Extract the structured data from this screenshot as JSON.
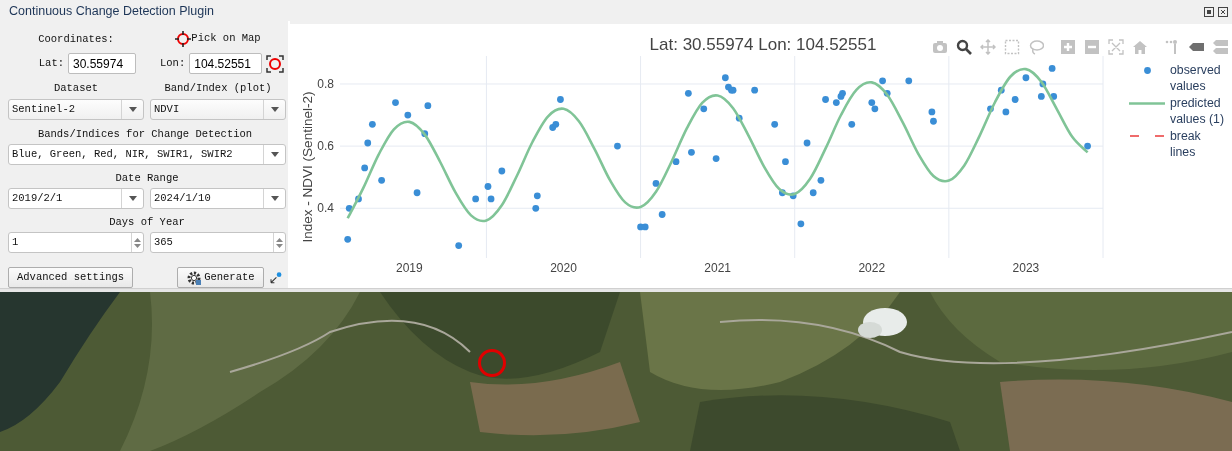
{
  "window": {
    "title": "Continuous Change Detection Plugin"
  },
  "coordinates": {
    "label": "Coordinates:",
    "pick_label": "Pick on Map",
    "lat_label": "Lat:",
    "lat": "30.55974",
    "lon_label": "Lon:",
    "lon": "104.52551"
  },
  "dataset": {
    "label": "Dataset",
    "value": "Sentinel-2"
  },
  "band_plot": {
    "label": "Band/Index (plot)",
    "value": "NDVI"
  },
  "bands_detection": {
    "label": "Bands/Indices for Change Detection",
    "value": "Blue, Green, Red, NIR, SWIR1, SWIR2"
  },
  "date_range": {
    "label": "Date Range",
    "start": "2019/2/1",
    "end": "2024/1/10"
  },
  "days_of_year": {
    "label": "Days of Year",
    "start": "1",
    "end": "365"
  },
  "buttons": [
    {
      "label": "Advanced settings",
      "kind": "plain"
    },
    {
      "label": "Generate",
      "kind": "gear"
    }
  ],
  "chart": {
    "toolbar": [
      {
        "kind": "camera",
        "selected": false
      },
      {
        "kind": "zoom",
        "selected": true
      },
      {
        "kind": "pan",
        "selected": false
      },
      {
        "kind": "box",
        "selected": false
      },
      {
        "kind": "lasso",
        "selected": false
      },
      {
        "kind": "zoomin",
        "selected": false
      },
      {
        "kind": "zoomout",
        "selected": false
      },
      {
        "kind": "autoscale",
        "selected": false
      },
      {
        "kind": "home",
        "selected": false
      },
      {
        "kind": "spike",
        "selected": false
      },
      {
        "kind": "closest",
        "selected": true
      },
      {
        "kind": "compare",
        "selected": false
      }
    ],
    "chart_data": {
      "type": "scatter",
      "title": "Lat: 30.55974 Lon: 104.52551",
      "ylabel": "Index - NDVI (Sentinel-2)",
      "xlim": [
        2019.05,
        2024.0
      ],
      "ylim": [
        0.24,
        0.89
      ],
      "grid": true,
      "xticks": [
        {
          "value": 2019.5,
          "label": "2019"
        },
        {
          "value": 2020.5,
          "label": "2020"
        },
        {
          "value": 2021.5,
          "label": "2021"
        },
        {
          "value": 2022.5,
          "label": "2022"
        },
        {
          "value": 2023.5,
          "label": "2023"
        }
      ],
      "yticks": [
        0.4,
        0.6,
        0.8
      ],
      "series": [
        {
          "name": "observed values",
          "color": "#3a8ed6",
          "type": "scatter",
          "x": [
            2019.1,
            2019.11,
            2019.17,
            2019.21,
            2019.23,
            2019.26,
            2019.32,
            2019.41,
            2019.49,
            2019.55,
            2019.6,
            2019.62,
            2019.82,
            2019.93,
            2020.01,
            2020.03,
            2020.1,
            2020.32,
            2020.33,
            2020.43,
            2020.45,
            2020.48,
            2020.85,
            2021.0,
            2021.03,
            2021.1,
            2021.14,
            2021.23,
            2021.31,
            2021.33,
            2021.41,
            2021.49,
            2021.55,
            2021.57,
            2021.59,
            2021.6,
            2021.64,
            2021.74,
            2021.87,
            2021.92,
            2021.94,
            2021.99,
            2022.04,
            2022.08,
            2022.12,
            2022.17,
            2022.2,
            2022.27,
            2022.3,
            2022.31,
            2022.37,
            2022.5,
            2022.52,
            2022.57,
            2022.6,
            2022.74,
            2022.89,
            2022.9,
            2023.27,
            2023.34,
            2023.37,
            2023.43,
            2023.5,
            2023.6,
            2023.61,
            2023.67,
            2023.68,
            2023.9
          ],
          "values": [
            0.3,
            0.4,
            0.43,
            0.53,
            0.61,
            0.67,
            0.49,
            0.74,
            0.7,
            0.45,
            0.64,
            0.73,
            0.28,
            0.43,
            0.47,
            0.43,
            0.52,
            0.4,
            0.44,
            0.66,
            0.67,
            0.75,
            0.6,
            0.34,
            0.34,
            0.48,
            0.38,
            0.55,
            0.77,
            0.58,
            0.72,
            0.56,
            0.82,
            0.79,
            0.78,
            0.78,
            0.69,
            0.78,
            0.67,
            0.45,
            0.55,
            0.44,
            0.35,
            0.61,
            0.45,
            0.49,
            0.75,
            0.74,
            0.76,
            0.77,
            0.67,
            0.74,
            0.72,
            0.81,
            0.77,
            0.81,
            0.71,
            0.68,
            0.72,
            0.78,
            0.71,
            0.75,
            0.82,
            0.76,
            0.8,
            0.85,
            0.76,
            0.6
          ]
        },
        {
          "name": "predicted values (1)",
          "color": "#80c497",
          "type": "line",
          "x": [
            2019.1,
            2019.2,
            2019.3,
            2019.4,
            2019.5,
            2019.6,
            2019.7,
            2019.8,
            2019.9,
            2020.0,
            2020.1,
            2020.2,
            2020.3,
            2020.4,
            2020.5,
            2020.6,
            2020.7,
            2020.8,
            2020.9,
            2021.0,
            2021.1,
            2021.2,
            2021.3,
            2021.4,
            2021.5,
            2021.6,
            2021.7,
            2021.8,
            2021.9,
            2022.0,
            2022.1,
            2022.2,
            2022.3,
            2022.4,
            2022.5,
            2022.6,
            2022.7,
            2022.8,
            2022.9,
            2023.0,
            2023.1,
            2023.2,
            2023.3,
            2023.4,
            2023.5,
            2023.6,
            2023.7,
            2023.8,
            2023.9
          ],
          "values": [
            0.368,
            0.464,
            0.572,
            0.654,
            0.678,
            0.637,
            0.549,
            0.45,
            0.377,
            0.361,
            0.41,
            0.507,
            0.615,
            0.696,
            0.72,
            0.68,
            0.592,
            0.492,
            0.419,
            0.404,
            0.453,
            0.549,
            0.657,
            0.739,
            0.763,
            0.722,
            0.634,
            0.535,
            0.462,
            0.446,
            0.495,
            0.592,
            0.7,
            0.781,
            0.805,
            0.765,
            0.677,
            0.577,
            0.504,
            0.489,
            0.538,
            0.634,
            0.742,
            0.824,
            0.848,
            0.807,
            0.719,
            0.63,
            0.58
          ]
        }
      ]
    },
    "legend_extra": [
      {
        "label": "break lines",
        "color": "#ef6b6b",
        "kind": "dash"
      }
    ]
  },
  "map": {
    "kind": "picture",
    "marker": true
  }
}
